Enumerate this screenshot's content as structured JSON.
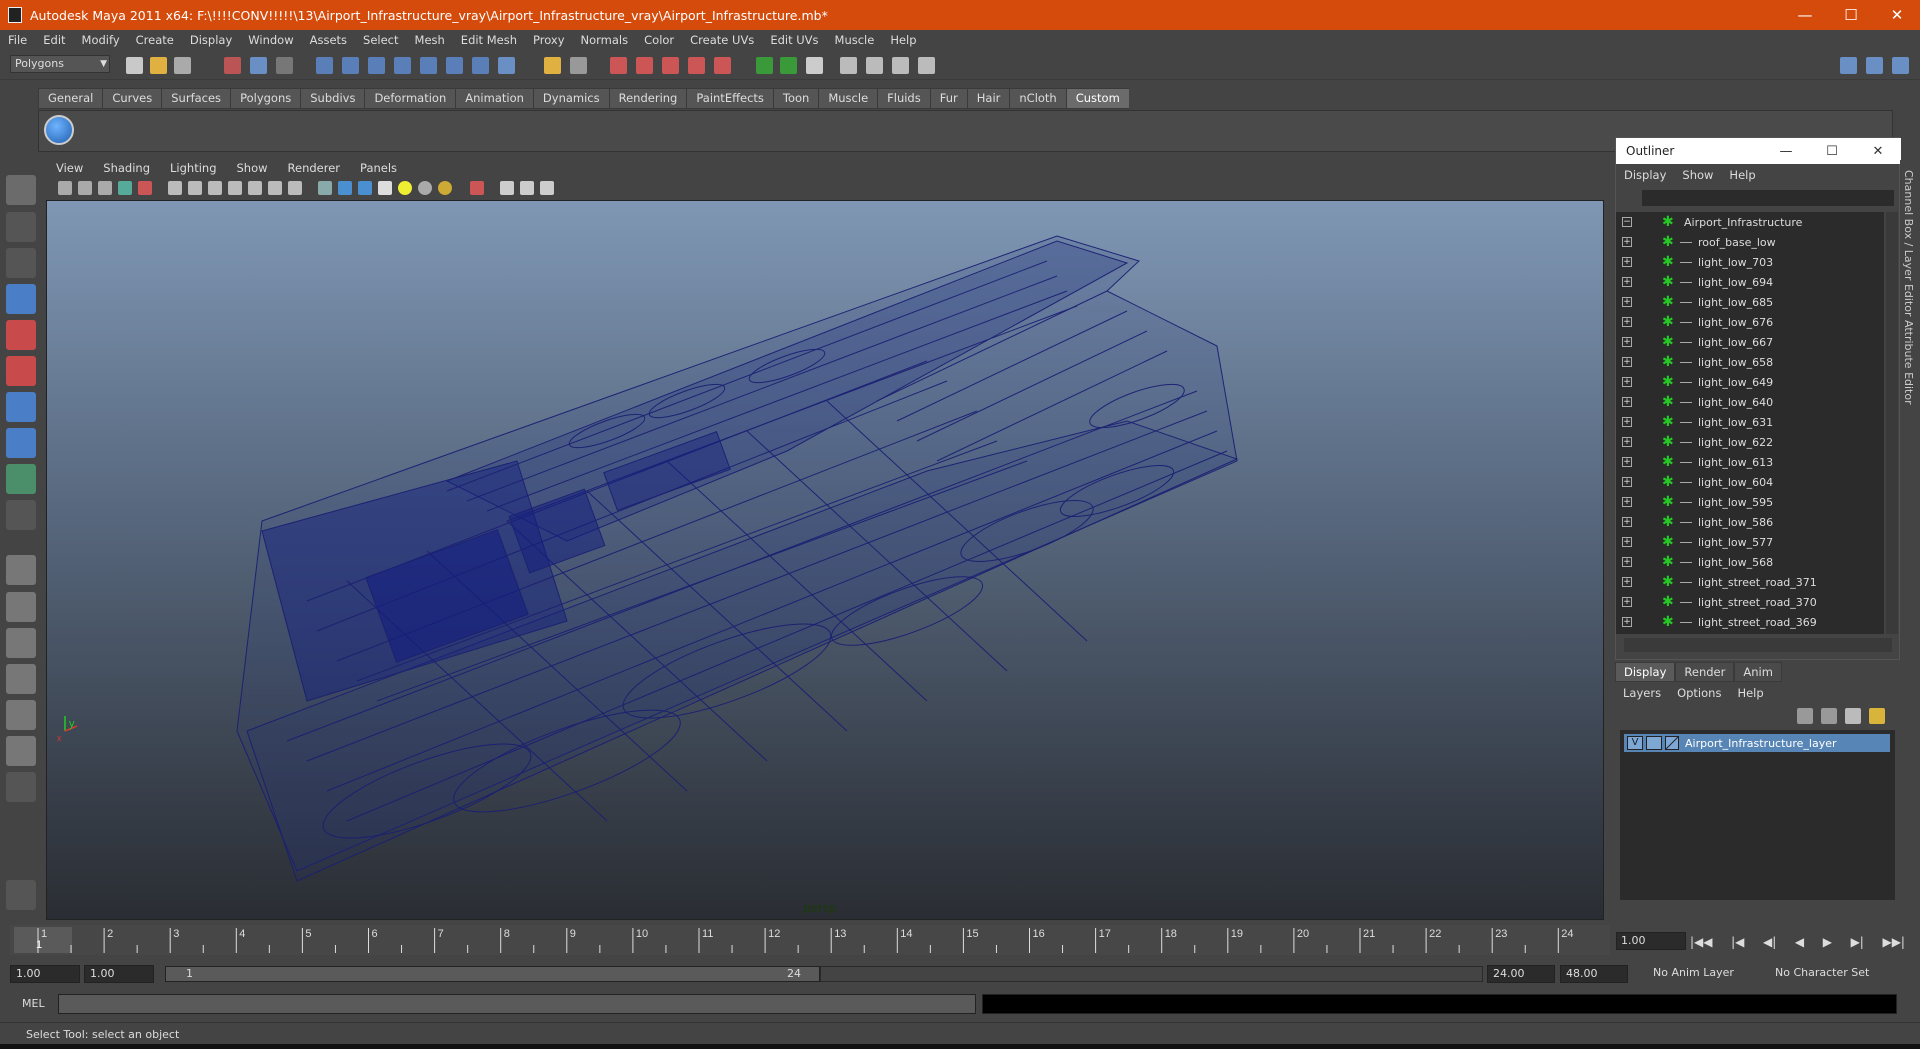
{
  "window": {
    "title": "Autodesk Maya 2011 x64: F:\\!!!!CONV!!!!!\\13\\Airport_Infrastructure_vray\\Airport_Infrastructure_vray\\Airport_Infrastructure.mb*",
    "minimize": "—",
    "maximize": "☐",
    "close": "✕"
  },
  "menubar": [
    "File",
    "Edit",
    "Modify",
    "Create",
    "Display",
    "Window",
    "Assets",
    "Select",
    "Mesh",
    "Edit Mesh",
    "Proxy",
    "Normals",
    "Color",
    "Create UVs",
    "Edit UVs",
    "Muscle",
    "Help"
  ],
  "status_line": {
    "mode": "Polygons"
  },
  "shelf": {
    "tabs": [
      "General",
      "Curves",
      "Surfaces",
      "Polygons",
      "Subdivs",
      "Deformation",
      "Animation",
      "Dynamics",
      "Rendering",
      "PaintEffects",
      "Toon",
      "Muscle",
      "Fluids",
      "Fur",
      "Hair",
      "nCloth",
      "Custom"
    ],
    "active_tab": "Custom"
  },
  "viewport": {
    "menu": [
      "View",
      "Shading",
      "Lighting",
      "Show",
      "Renderer",
      "Panels"
    ],
    "camera_label": "persp",
    "axis_y": "y",
    "axis_x": "x"
  },
  "outliner": {
    "title": "Outliner",
    "menu": [
      "Display",
      "Show",
      "Help"
    ],
    "items": [
      "Airport_Infrastructure",
      "roof_base_low",
      "light_low_703",
      "light_low_694",
      "light_low_685",
      "light_low_676",
      "light_low_667",
      "light_low_658",
      "light_low_649",
      "light_low_640",
      "light_low_631",
      "light_low_622",
      "light_low_613",
      "light_low_604",
      "light_low_595",
      "light_low_586",
      "light_low_577",
      "light_low_568",
      "light_street_road_371",
      "light_street_road_370",
      "light_street_road_369"
    ]
  },
  "side_tabs": [
    "Channel Box / Layer Editor",
    "Attribute Editor"
  ],
  "layer_editor": {
    "tabs": [
      "Display",
      "Render",
      "Anim"
    ],
    "active_tab": "Display",
    "menu": [
      "Layers",
      "Options",
      "Help"
    ],
    "layer": {
      "visible": "V",
      "name": "Airport_Infrastructure_layer"
    }
  },
  "timeline": {
    "ticks": [
      "1",
      "2",
      "3",
      "4",
      "5",
      "6",
      "7",
      "8",
      "9",
      "10",
      "11",
      "12",
      "13",
      "14",
      "15",
      "16",
      "17",
      "18",
      "19",
      "20",
      "21",
      "22",
      "23",
      "24"
    ],
    "current_frame_label": "1",
    "current_frame_field": "1.00"
  },
  "playback": [
    "|◀◀",
    "|◀",
    "◀|",
    "◀",
    "▶",
    "▶|",
    "▶▶|"
  ],
  "range": {
    "start_time": "1.00",
    "playback_start": "1.00",
    "bar_start": "1",
    "bar_end": "24",
    "playback_end": "24.00",
    "end_time": "48.00",
    "anim_layer": "No Anim Layer",
    "character_set": "No Character Set"
  },
  "command_line": {
    "label": "MEL"
  },
  "help_line": "Select Tool: select an object"
}
